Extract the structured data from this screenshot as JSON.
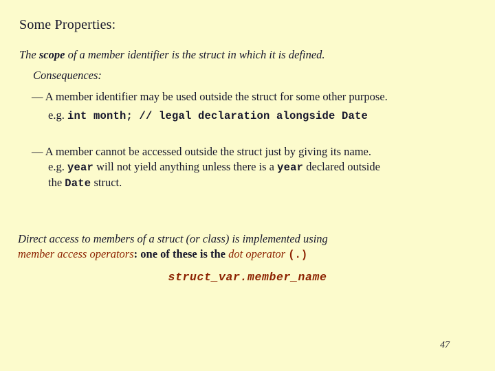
{
  "slide": {
    "background_color": "#FCFBCC",
    "text_color": "#16162B",
    "accent_color": "#8C2200",
    "title": "Some Properties:",
    "page_number": "47"
  },
  "scope_statement": {
    "prefix": "The ",
    "emphasis": "scope",
    "suffix": " of a member identifier is the struct in which it is defined."
  },
  "consequences": {
    "heading": "Consequences:",
    "items": [
      {
        "bullet": "— A member identifier may be used outside the struct for some other purpose.",
        "example_prefix": "e.g. ",
        "example_code": "int month; // legal declaration alongside Date"
      },
      {
        "bullet": "— A member cannot be accessed outside the struct just by giving its name.",
        "example_prefix": "e.g. ",
        "example_code_1": "year",
        "example_mid": " will not yield anything unless there is a ",
        "example_code_2": "year",
        "example_tail": " declared outside",
        "continuation_prefix": "the ",
        "continuation_code": "Date",
        "continuation_suffix": " struct."
      }
    ]
  },
  "direct_access": {
    "line1": "Direct access to members of a struct (or class) is implemented using",
    "line2_term": "member access operators",
    "line2_colon": ":  ",
    "line2_mid": "one of these is the ",
    "line2_term2": "dot operator",
    "line2_space": " ",
    "line2_symbol": "(.)",
    "expression": "struct_var.member_name"
  }
}
